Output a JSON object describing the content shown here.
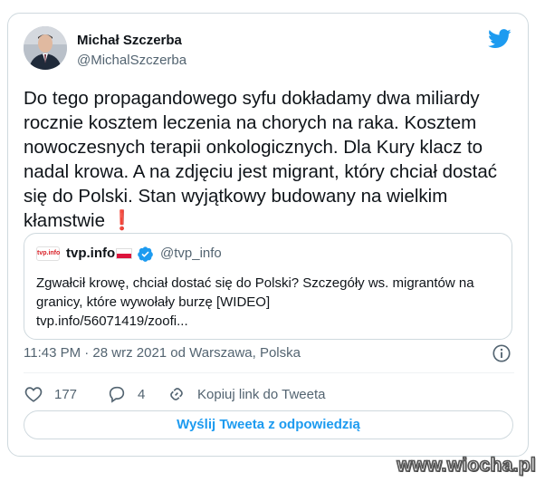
{
  "author": {
    "name": "Michał Szczerba",
    "handle": "@MichalSzczerba"
  },
  "tweet": {
    "text": "Do tego propagandowego syfu dokładamy dwa miliardy\nrocznie kosztem leczenia na chorych na raka. Kosztem\nnowoczesnych terapii onkologicznych. Dla Kury klacz to\nnadal krowa. A na zdjęciu jest migrant, który chciał dostać\nsię do Polski. Stan wyjątkowy budowany na wielkim\nkłamstwie ",
    "emoji": "❗"
  },
  "quote": {
    "logo_text": "tvp.info",
    "name": "tvp.info",
    "handle": "@tvp_info",
    "text": "Zgwałcił krowę, chciał dostać się do Polski? Szczegóły ws. migrantów na granicy, które wywołały burzę [WIDEO]",
    "link": "tvp.info/56071419/zoofi..."
  },
  "meta": {
    "timestamp": "11:43 PM · 28 wrz 2021 od Warszawa, Polska"
  },
  "actions": {
    "likes": "177",
    "replies": "4",
    "copy_link_label": "Kopiuj link do Tweeta"
  },
  "reply_button_label": "Wyślij Tweeta z odpowiedzią",
  "watermark": "www.wiocha.pl",
  "colors": {
    "twitter_blue": "#1d9bf0",
    "text": "#0f1419",
    "secondary_text": "#536471",
    "border": "#cfd9de"
  }
}
